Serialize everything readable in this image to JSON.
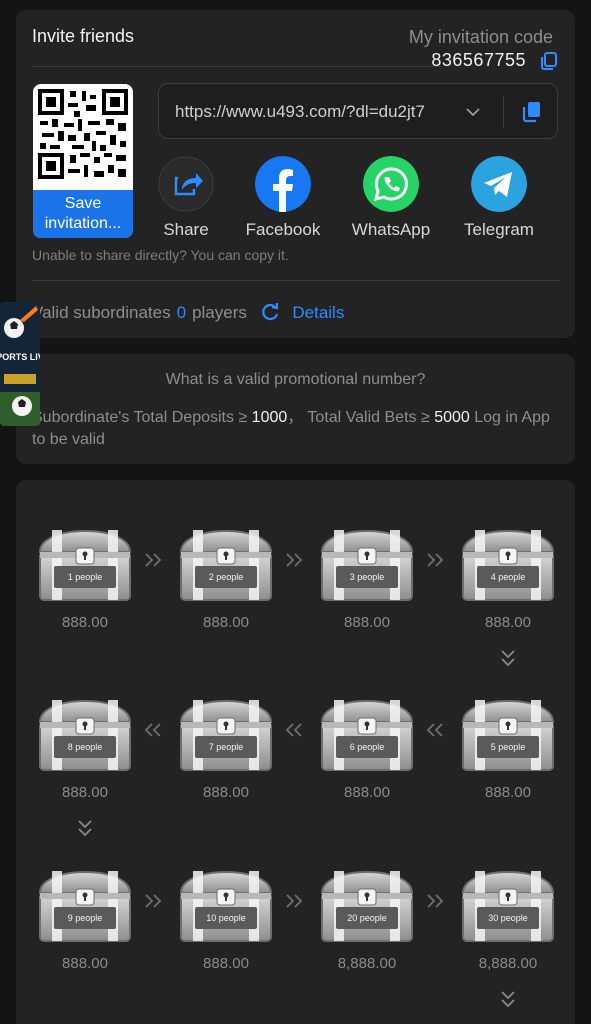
{
  "invite": {
    "title": "Invite friends",
    "code_label": "My invitation code",
    "code_value": "836567755",
    "qr_button": "Save invitation...",
    "url": "https://www.u493.com/?dl=du2jt7",
    "share_options": [
      {
        "label": "Share",
        "icon": "share-icon",
        "color": "#2d2d2d"
      },
      {
        "label": "Facebook",
        "icon": "facebook-icon",
        "color": "#1877f2"
      },
      {
        "label": "WhatsApp",
        "icon": "whatsapp-icon",
        "color": "#25d366"
      },
      {
        "label": "Telegram",
        "icon": "telegram-icon",
        "color": "#2aa3e0"
      }
    ],
    "share_note": "Unable to share directly? You can copy it.",
    "subordinates_label": "Valid subordinates",
    "subordinates_count": "0",
    "subordinates_unit": "players",
    "details_label": "Details"
  },
  "promo": {
    "question": "What is a valid promotional number?",
    "rule_prefix": "Subordinate's Total Deposits ≥ ",
    "rule_deposit": "1000",
    "rule_mid": "，  Total Valid Bets ≥ ",
    "rule_bets": "5000",
    "rule_suffix": " Log in App to be valid"
  },
  "badge": {
    "text": "SPORTS LIVE"
  },
  "rewards": [
    {
      "label": "1 people",
      "value": "888.00"
    },
    {
      "label": "2 people",
      "value": "888.00"
    },
    {
      "label": "3 people",
      "value": "888.00"
    },
    {
      "label": "4 people",
      "value": "888.00"
    },
    {
      "label": "5 people",
      "value": "888.00"
    },
    {
      "label": "6 people",
      "value": "888.00"
    },
    {
      "label": "7 people",
      "value": "888.00"
    },
    {
      "label": "8 people",
      "value": "888.00"
    },
    {
      "label": "9 people",
      "value": "888.00"
    },
    {
      "label": "10 people",
      "value": "888.00"
    },
    {
      "label": "20 people",
      "value": "8,888.00"
    },
    {
      "label": "30 people",
      "value": "8,888.00"
    }
  ],
  "colors": {
    "accent": "#2d8cff",
    "card": "#232323",
    "background": "#141414"
  }
}
